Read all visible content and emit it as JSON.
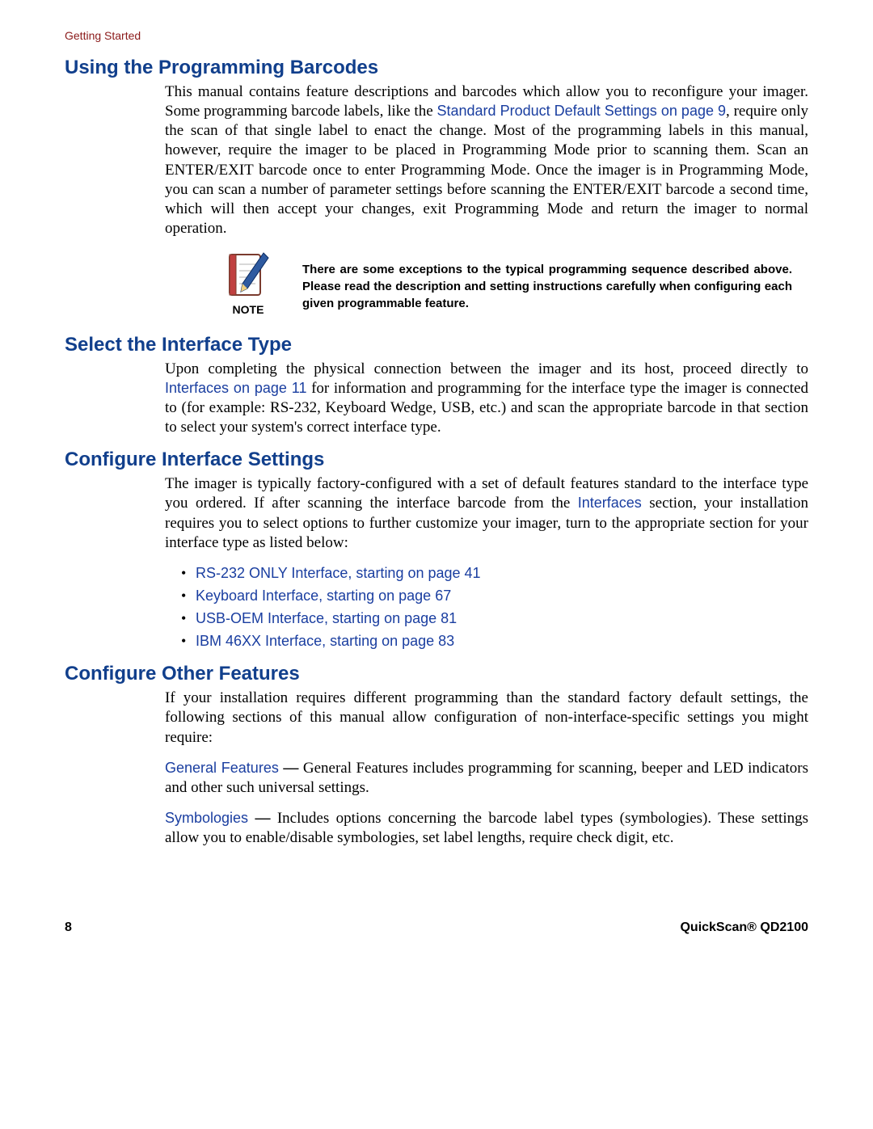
{
  "header": {
    "running": "Getting Started"
  },
  "footer": {
    "page": "8",
    "product": "QuickScan® QD2100"
  },
  "s1": {
    "title": "Using the Programming Barcodes",
    "p1a": "This manual contains feature descriptions and barcodes which allow you to reconfigure your imager. Some programming barcode labels, like the ",
    "link1": "Standard Product Default Settings on page 9",
    "p1b": ", require only the scan of that single label to enact the change. Most of the programming labels in this manual, however, require the imager to be placed in Programming Mode prior to scanning them. Scan an ENTER/EXIT barcode once to enter Programming Mode. Once the imager is in Programming Mode, you can scan a number of parameter settings before scanning the ENTER/EXIT barcode a second time, which will then accept your changes, exit Programming Mode and return the imager to normal operation.",
    "note_label": "NOTE",
    "note_text": "There are some exceptions to the typical programming sequence described above. Please read the description and setting instructions carefully when configuring each given programmable feature."
  },
  "s2": {
    "title": "Select the Interface Type",
    "p1a": "Upon completing the physical connection between the imager and its host, proceed directly to ",
    "link1": "Interfaces on page 11",
    "p1b": " for information and programming for the interface type the imager is connected to (for example: RS-232, Keyboard Wedge, USB, etc.) and scan the appropriate barcode in that section to select your system's correct interface type."
  },
  "s3": {
    "title": "Configure Interface Settings",
    "p1a": "The imager is typically factory-configured with a set of default features standard to the interface type you ordered. If after scanning the interface barcode from the ",
    "link1": "Interfaces",
    "p1b": " section, your installation requires you to select  options to further customize your imager, turn to the appropriate section for your interface type as listed below:",
    "bullets": [
      "RS-232 ONLY Interface, starting on page 41",
      "Keyboard Interface, starting on page 67",
      "USB-OEM Interface, starting on page 81",
      "IBM 46XX Interface, starting on page 83"
    ]
  },
  "s4": {
    "title": "Configure Other Features",
    "intro": "If your installation requires different programming than the standard factory default settings, the following sections of this manual allow configuration of non-interface-specific settings you might require:",
    "gf_label": "General Features",
    "gf_text": "General Features includes programming for scanning, beeper and LED indicators and other such universal settings.",
    "sym_label": "Symbologies",
    "sym_text": "Includes options concerning the barcode label types (symbologies). These settings allow you to enable/disable symbologies, set label lengths, require check digit, etc."
  }
}
